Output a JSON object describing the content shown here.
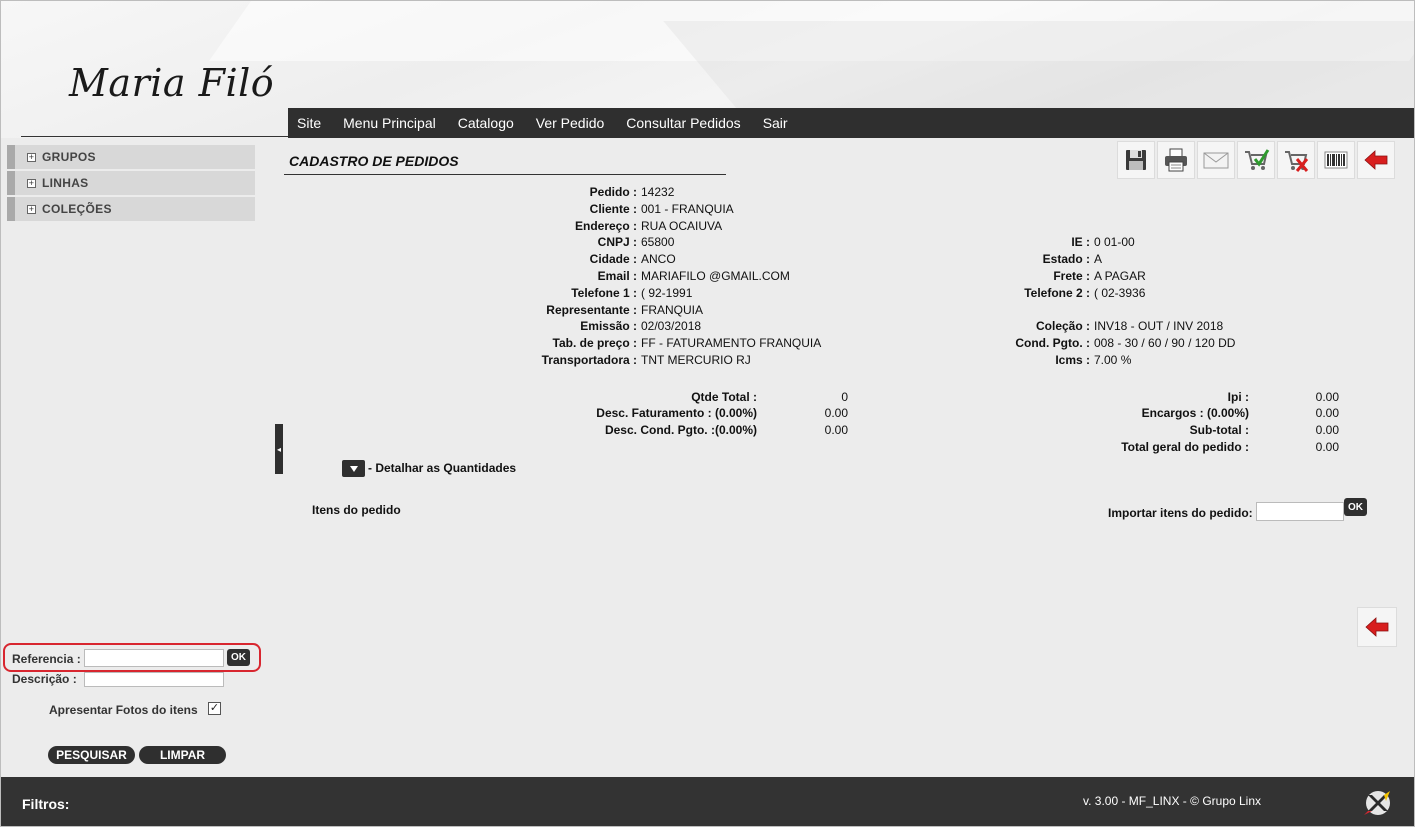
{
  "brand": {
    "logo_text": "Maria Filó"
  },
  "nav": {
    "items": [
      "Site",
      "Menu Principal",
      "Catalogo",
      "Ver Pedido",
      "Consultar Pedidos",
      "Sair"
    ]
  },
  "sidebar": {
    "items": [
      "GRUPOS",
      "LINHAS",
      "COLEÇÕES"
    ]
  },
  "page": {
    "title": "CADASTRO DE PEDIDOS"
  },
  "toolbar": {
    "icons": [
      "save-icon",
      "print-icon",
      "email-icon",
      "cart-approve-icon",
      "cart-delete-icon",
      "barcode-icon",
      "back-arrow-icon"
    ]
  },
  "order": {
    "pedido_label": "Pedido :",
    "pedido": "14232",
    "cliente_label": "Cliente :",
    "cliente": "001        - FRANQUIA",
    "endereco_label": "Endereço :",
    "endereco": "RUA                          OCAIUVA",
    "cnpj_label": "CNPJ :",
    "cnpj": "          65800",
    "cidade_label": "Cidade :",
    "cidade": "             ANCO",
    "email_label": "Email :",
    "email": "MARIAFILO       @GMAIL.COM",
    "telefone1_label": "Telefone 1 :",
    "telefone1": "(          92-1991",
    "representante_label": "Representante :",
    "representante": "FRANQUIA",
    "emissao_label": "Emissão :",
    "emissao": "02/03/2018",
    "tabpreco_label": "Tab. de preço :",
    "tabpreco": "FF - FATURAMENTO FRANQUIA",
    "transportadora_label": "Transportadora :",
    "transportadora": "TNT MERCURIO RJ",
    "ie_label": "IE :",
    "ie": "0                     01-00",
    "estado_label": "Estado :",
    "estado": "A",
    "frete_label": "Frete :",
    "frete": "A PAGAR",
    "telefone2_label": "Telefone 2 :",
    "telefone2": "(          02-3936",
    "colecao_label": "Coleção :",
    "colecao": "INV18 - OUT / INV 2018",
    "condpgto_label": "Cond. Pgto. :",
    "condpgto": "008 - 30 / 60 / 90 / 120 DD",
    "icms_label": "Icms :",
    "icms": "7.00 %"
  },
  "totals": {
    "qtde_label": "Qtde Total :",
    "qtde": "0",
    "descfat_label": "Desc. Faturamento : (0.00%)",
    "descfat": "0.00",
    "desccond_label": "Desc. Cond. Pgto. :(0.00%)",
    "desccond": "0.00",
    "ipi_label": "Ipi :",
    "ipi": "0.00",
    "encargos_label": "Encargos : (0.00%)",
    "encargos": "0.00",
    "subtotal_label": "Sub-total :",
    "subtotal": "0.00",
    "totalgeral_label": "Total geral do pedido :",
    "totalgeral": "0.00"
  },
  "detail": {
    "label": "- Detalhar as Quantidades"
  },
  "items": {
    "label": "Itens do pedido",
    "import_label": "Importar itens do pedido:",
    "import_value": "",
    "ok_label": "OK"
  },
  "filters": {
    "referencia_label": "Referencia :",
    "referencia_value": "",
    "ok_label": "OK",
    "descricao_label": "Descrição  :",
    "descricao_value": "",
    "fotos_label": "Apresentar Fotos do itens",
    "fotos_checked": "✓",
    "pesquisar_label": "PESQUISAR",
    "limpar_label": "LIMPAR"
  },
  "footer": {
    "filters_label": "Filtros:",
    "version": "v. 3.00 - MF_LINX - © Grupo Linx"
  },
  "colors": {
    "nav_bg": "#2f2f2f",
    "highlight": "#d8262f",
    "back_arrow": "#d81e1e"
  }
}
